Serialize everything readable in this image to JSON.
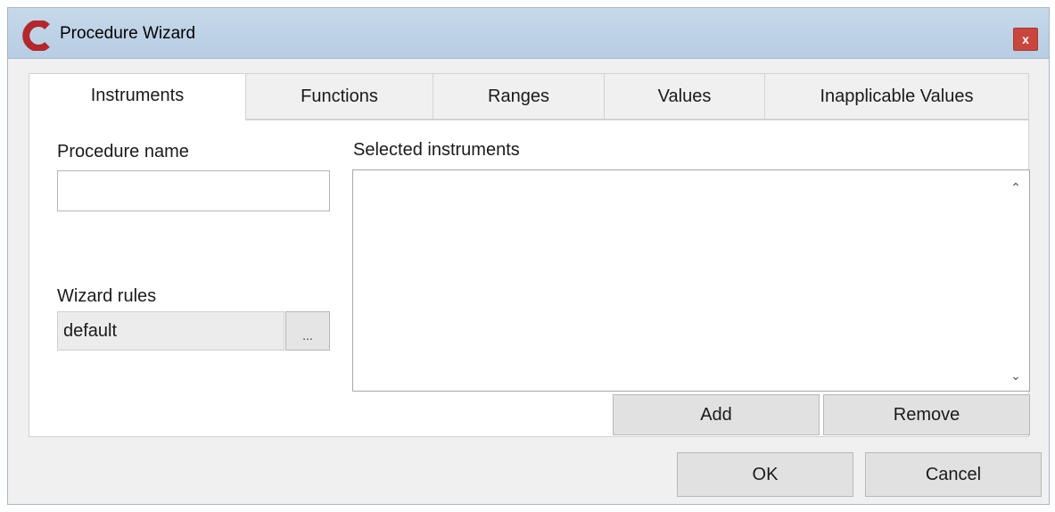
{
  "window": {
    "title": "Procedure Wizard",
    "close_label": "x"
  },
  "tabs": [
    {
      "label": "Instruments",
      "active": true
    },
    {
      "label": "Functions",
      "active": false
    },
    {
      "label": "Ranges",
      "active": false
    },
    {
      "label": "Values",
      "active": false
    },
    {
      "label": "Inapplicable Values",
      "active": false
    }
  ],
  "form": {
    "procedure_name_label": "Procedure name",
    "procedure_name_value": "",
    "wizard_rules_label": "Wizard rules",
    "wizard_rules_value": "default",
    "browse_label": "...",
    "selected_instruments_label": "Selected instruments",
    "selected_instruments": [],
    "add_label": "Add",
    "remove_label": "Remove"
  },
  "footer": {
    "ok_label": "OK",
    "cancel_label": "Cancel"
  },
  "colors": {
    "titlebar": "#c6d8ea",
    "close_button": "#c9463d",
    "app_icon": "#b3272d"
  },
  "icons": {
    "app": "app-logo-c-icon",
    "close": "close-icon",
    "scroll_up": "chevron-up-icon",
    "scroll_down": "chevron-down-icon"
  }
}
